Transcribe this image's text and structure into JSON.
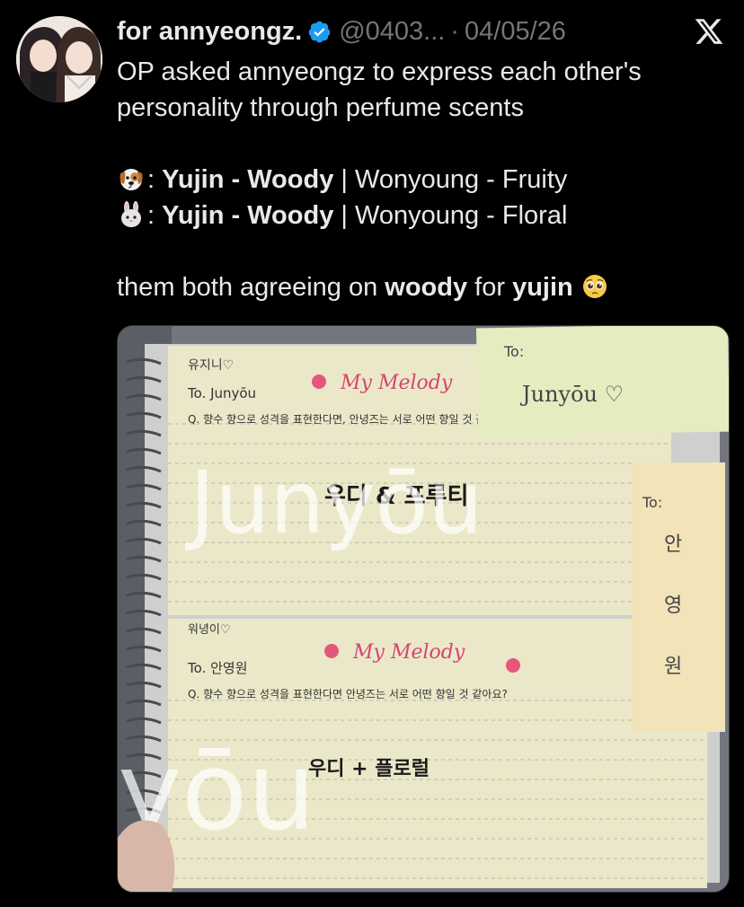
{
  "tweet": {
    "display_name": "for annyeongz.",
    "handle": "@0403...",
    "separator": "·",
    "date": "04/05/26",
    "intro_line_1": "OP asked annyeongz to express each other's",
    "intro_line_2": "personality through perfume scents",
    "row1": {
      "emoji_icon": "dog-face-icon",
      "prefix": ": ",
      "name_a": "Yujin",
      "dash_a": " - ",
      "scent_a": "Woody",
      "divider": " | ",
      "name_b": "Wonyoung",
      "dash_b": " - ",
      "scent_b": "Fruity"
    },
    "row2": {
      "emoji_icon": "rabbit-face-icon",
      "prefix": ": ",
      "name_a": "Yujin",
      "dash_a": " - ",
      "scent_a": "Woody",
      "divider": " | ",
      "name_b": "Wonyoung",
      "dash_b": " - ",
      "scent_b": "Floral"
    },
    "closing": {
      "part1": "them both agreeing on ",
      "bold1": "woody",
      "part2": " for ",
      "bold2": "yujin",
      "emoji_icon": "pleading-face-icon"
    }
  },
  "media": {
    "description_icon": "photo-notebook",
    "sticky_top": {
      "to": "To:",
      "name": "Junyōu ♡"
    },
    "sticky_side": {
      "to": "To:",
      "line1": "안",
      "line2": "영",
      "line3": "원"
    },
    "card1": {
      "header": "유지니♡",
      "brand": "My Melody",
      "to": "To. Junyōu",
      "question": "Q. 향수 향으로 성격을 표현한다면, 안녕즈는 서로 어떤 향일 것 같아요?",
      "answer": "우디 & 프루티"
    },
    "card2": {
      "header": "워녕이♡",
      "brand": "My Melody",
      "to": "To. 안영원",
      "question": "Q. 향수 향으로 성격을 표현한다면 안녕즈는 서로 어떤 향일 것 같아요?",
      "answer": "우디 + 플로럴"
    },
    "watermark_1": "Junyōu",
    "watermark_2": "yōu"
  },
  "colors": {
    "background": "#000000",
    "text": "#e7e9ea",
    "muted": "#71767b",
    "verified": "#1d9bf0",
    "card": "#ebe8c9"
  }
}
